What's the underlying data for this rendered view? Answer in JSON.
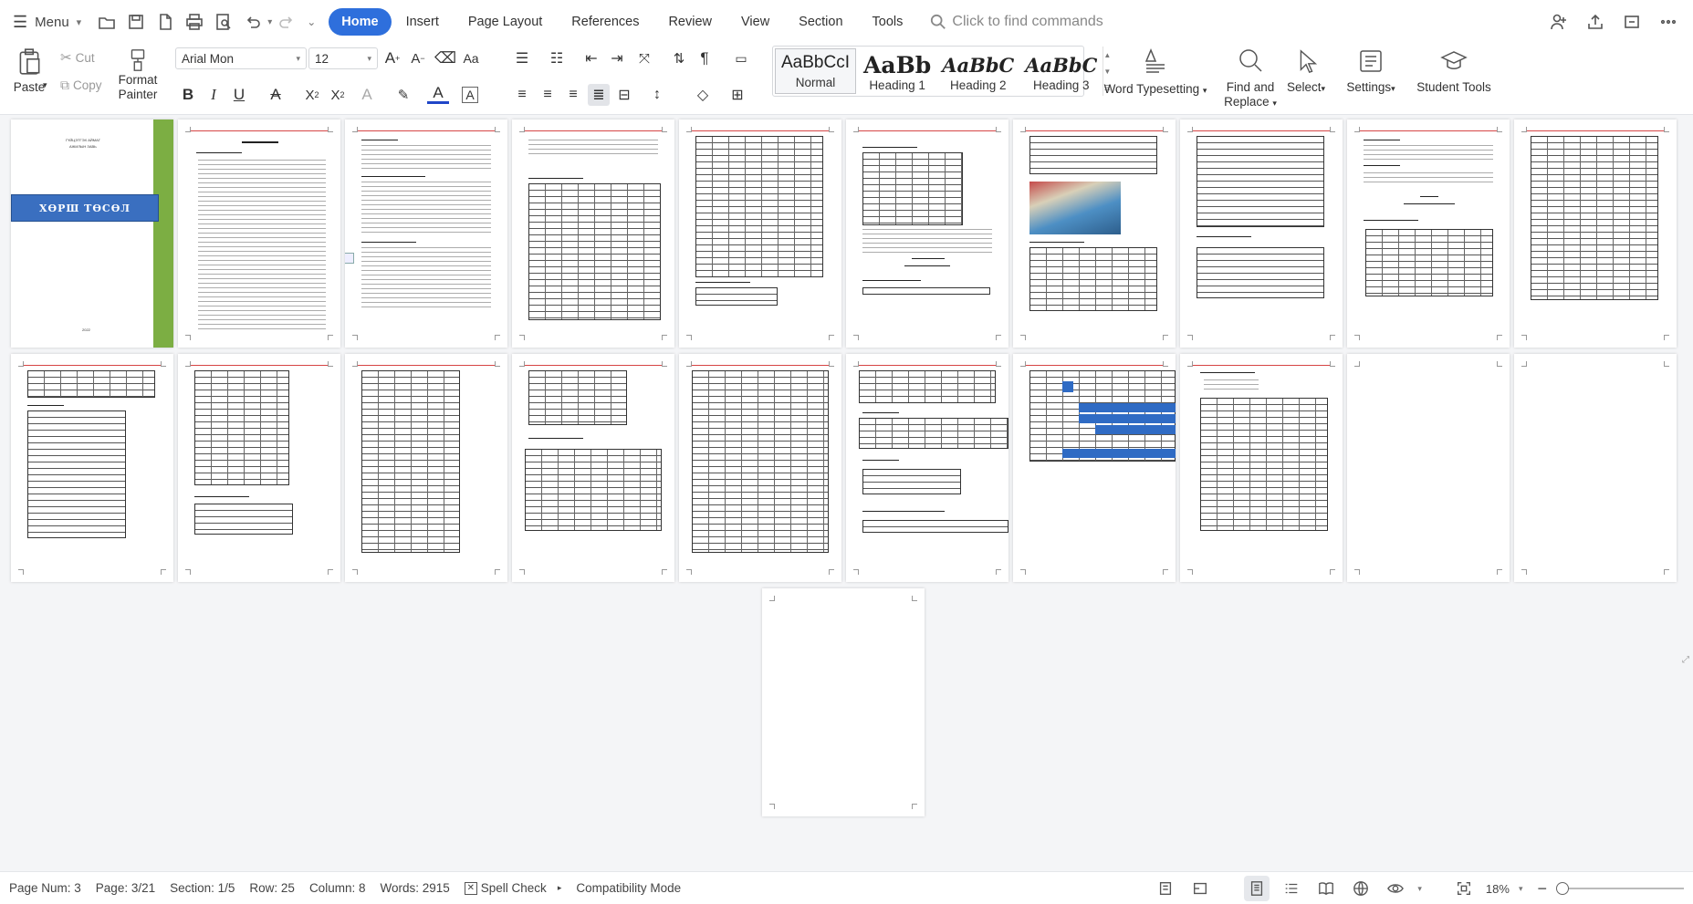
{
  "menubar": {
    "menu_label": "Menu",
    "tabs": [
      "Home",
      "Insert",
      "Page Layout",
      "References",
      "Review",
      "View",
      "Section",
      "Tools"
    ],
    "search_placeholder": "Click to find commands"
  },
  "ribbon": {
    "paste": "Paste",
    "cut": "Cut",
    "copy": "Copy",
    "format_painter_line1": "Format",
    "format_painter_line2": "Painter",
    "font_name": "Arial Mon",
    "font_size": "12",
    "styles": [
      {
        "sample": "AaBbCcI",
        "name": "Normal"
      },
      {
        "sample": "AaBb",
        "name": "Heading 1"
      },
      {
        "sample": "AaBbC",
        "name": "Heading 2"
      },
      {
        "sample": "AaBbC",
        "name": "Heading 3"
      }
    ],
    "word_typesetting": "Word Typesetting",
    "find_replace_line1": "Find and",
    "find_replace_line2": "Replace",
    "select": "Select",
    "settings": "Settings",
    "student_tools": "Student Tools"
  },
  "document": {
    "cover_title": "ХӨРШ ТӨСӨЛ",
    "cover_top_line1": "ГҮЙЦЭТГЭХ АЙМАГ",
    "cover_top_line2": "АЖИЛЫН ЗАВЬ",
    "cover_bottom": "2022",
    "page_count": 21
  },
  "statusbar": {
    "page_num": "Page Num: 3",
    "page": "Page: 3/21",
    "section": "Section: 1/5",
    "row": "Row: 25",
    "column": "Column: 8",
    "words": "Words: 2915",
    "spell_check": "Spell Check",
    "compat": "Compatibility Mode",
    "zoom": "18%"
  },
  "colors": {
    "accent": "#2e6fdc",
    "cover_green": "#7cae43",
    "cover_blue": "#3a6fc0",
    "gantt_blue": "#2f6bc4",
    "header_red": "#d64545"
  }
}
